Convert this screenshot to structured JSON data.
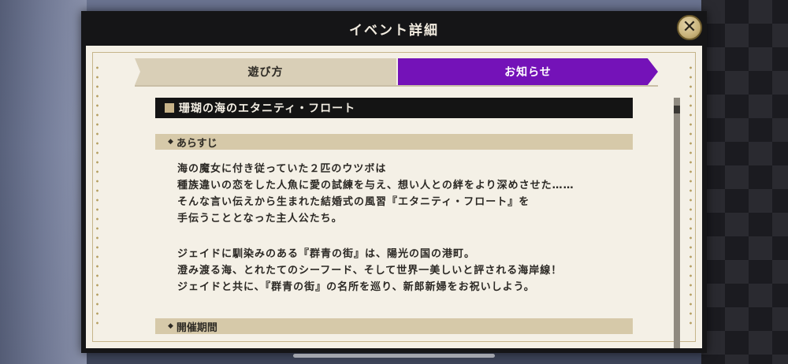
{
  "modal": {
    "title": "イベント詳細",
    "close_icon": "close-icon",
    "close_symbol": "✕"
  },
  "tabs": [
    {
      "label": "遊び方",
      "active": false
    },
    {
      "label": "お知らせ",
      "active": true
    }
  ],
  "colors": {
    "active_tab": "#7412b8",
    "inactive_tab": "#d9cfb7",
    "section_bar": "#d6c9a9",
    "title_bar": "#141414",
    "paper": "#f4f0e6"
  },
  "notice": {
    "event_title": "珊瑚の海のエタニティ・フロート",
    "section_marker": "◆",
    "synopsis_heading": "あらすじ",
    "synopsis_paragraph_1": [
      "海の魔女に付き従っていた２匹のウツボは",
      "種族違いの恋をした人魚に愛の試練を与え、想い人との絆をより深めさせた……",
      "そんな言い伝えから生まれた結婚式の風習『エタニティ・フロート』を",
      "手伝うこととなった主人公たち。"
    ],
    "synopsis_paragraph_2": [
      "ジェイドに馴染みのある『群青の街』は、陽光の国の港町。",
      "澄み渡る海、とれたてのシーフード、そして世界一美しいと評される海岸線！",
      "ジェイドと共に、『群青の街』の名所を巡り、新郎新婦をお祝いしよう。"
    ],
    "period_heading": "開催期間"
  }
}
